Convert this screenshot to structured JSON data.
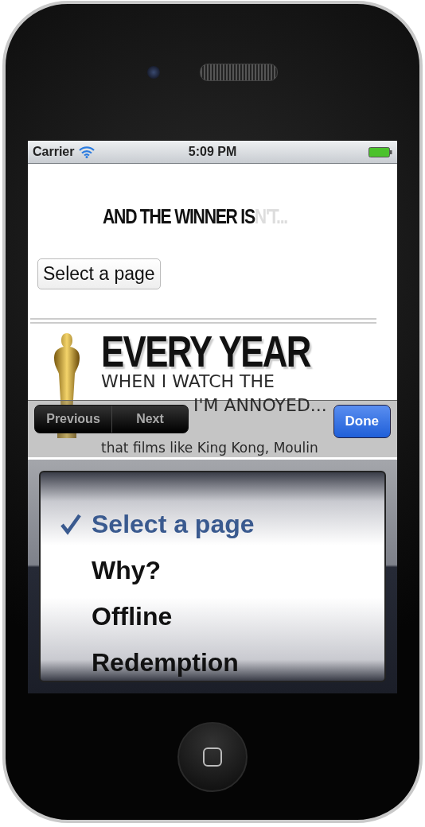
{
  "status_bar": {
    "carrier": "Carrier",
    "time": "5:09 PM"
  },
  "headline": {
    "text": "AND THE WINNER IS",
    "faded": "N'T..."
  },
  "select_button": {
    "label": "Select a page"
  },
  "article": {
    "title": "EVERY YEAR",
    "lines": [
      "WHEN I WATCH THE",
      "I'M ANNOYED...",
      "that films like King Kong, Moulin"
    ]
  },
  "toolbar": {
    "previous": "Previous",
    "next": "Next",
    "done": "Done"
  },
  "picker": {
    "options": [
      {
        "label": "Select a page",
        "selected": true
      },
      {
        "label": "Why?",
        "selected": false
      },
      {
        "label": "Offline",
        "selected": false
      },
      {
        "label": "Redemption",
        "selected": false
      }
    ]
  }
}
